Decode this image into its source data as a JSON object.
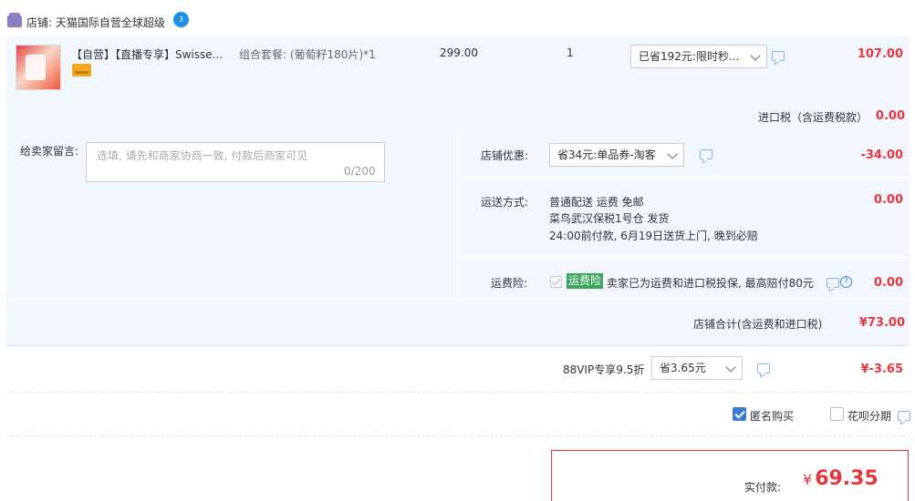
{
  "shop": {
    "name": "店铺: 天猫国际自营全球超级",
    "chat_glyph": "3"
  },
  "item": {
    "title": "【自营】【直播专享】Swisse...",
    "spec": "组合套餐: (葡萄籽180片)*1",
    "price": "299.00",
    "qty": "1",
    "promo_select": "已省192元:限时秒...",
    "amount": "107.00"
  },
  "tax": {
    "label": "进口税（含运费税款）",
    "value": "0.00"
  },
  "memo": {
    "label": "给卖家留言:",
    "placeholder": "选填, 请先和商家协商一致, 付款后商家可见",
    "count": "0/200"
  },
  "shop_coupon": {
    "label": "店铺优惠:",
    "select": "省34元:单品券-淘客",
    "amount": "-34.00"
  },
  "shipping": {
    "label": "运送方式:",
    "line1": "普通配送 运费 免邮",
    "line2": "菜鸟武汉保税1号仓  发货",
    "line3": "24:00前付款, 6月19日送货上门, 晚到必赔",
    "amount": "0.00"
  },
  "freight_insurance": {
    "label": "运费险:",
    "badge": "运费险",
    "text": "卖家已为运费和进口税投保, 最高赔付80元",
    "amount": "0.00"
  },
  "shop_total": {
    "label": "店铺合计(含运费和进口税)",
    "amount": "¥73.00"
  },
  "vip": {
    "label": "88VIP专享9.5折",
    "select": "省3.65元",
    "amount": "¥-3.65"
  },
  "options": {
    "anonymous": "匿名购买",
    "anonymous_checked": true,
    "huabei": "花呗分期",
    "huabei_checked": false
  },
  "payment": {
    "label": "实付款:",
    "currency": "¥",
    "amount": "69.35"
  },
  "colors": {
    "accent_red": "#e4393c",
    "row_bg": "#f2f7ff",
    "link_blue": "#3a7bd5"
  }
}
